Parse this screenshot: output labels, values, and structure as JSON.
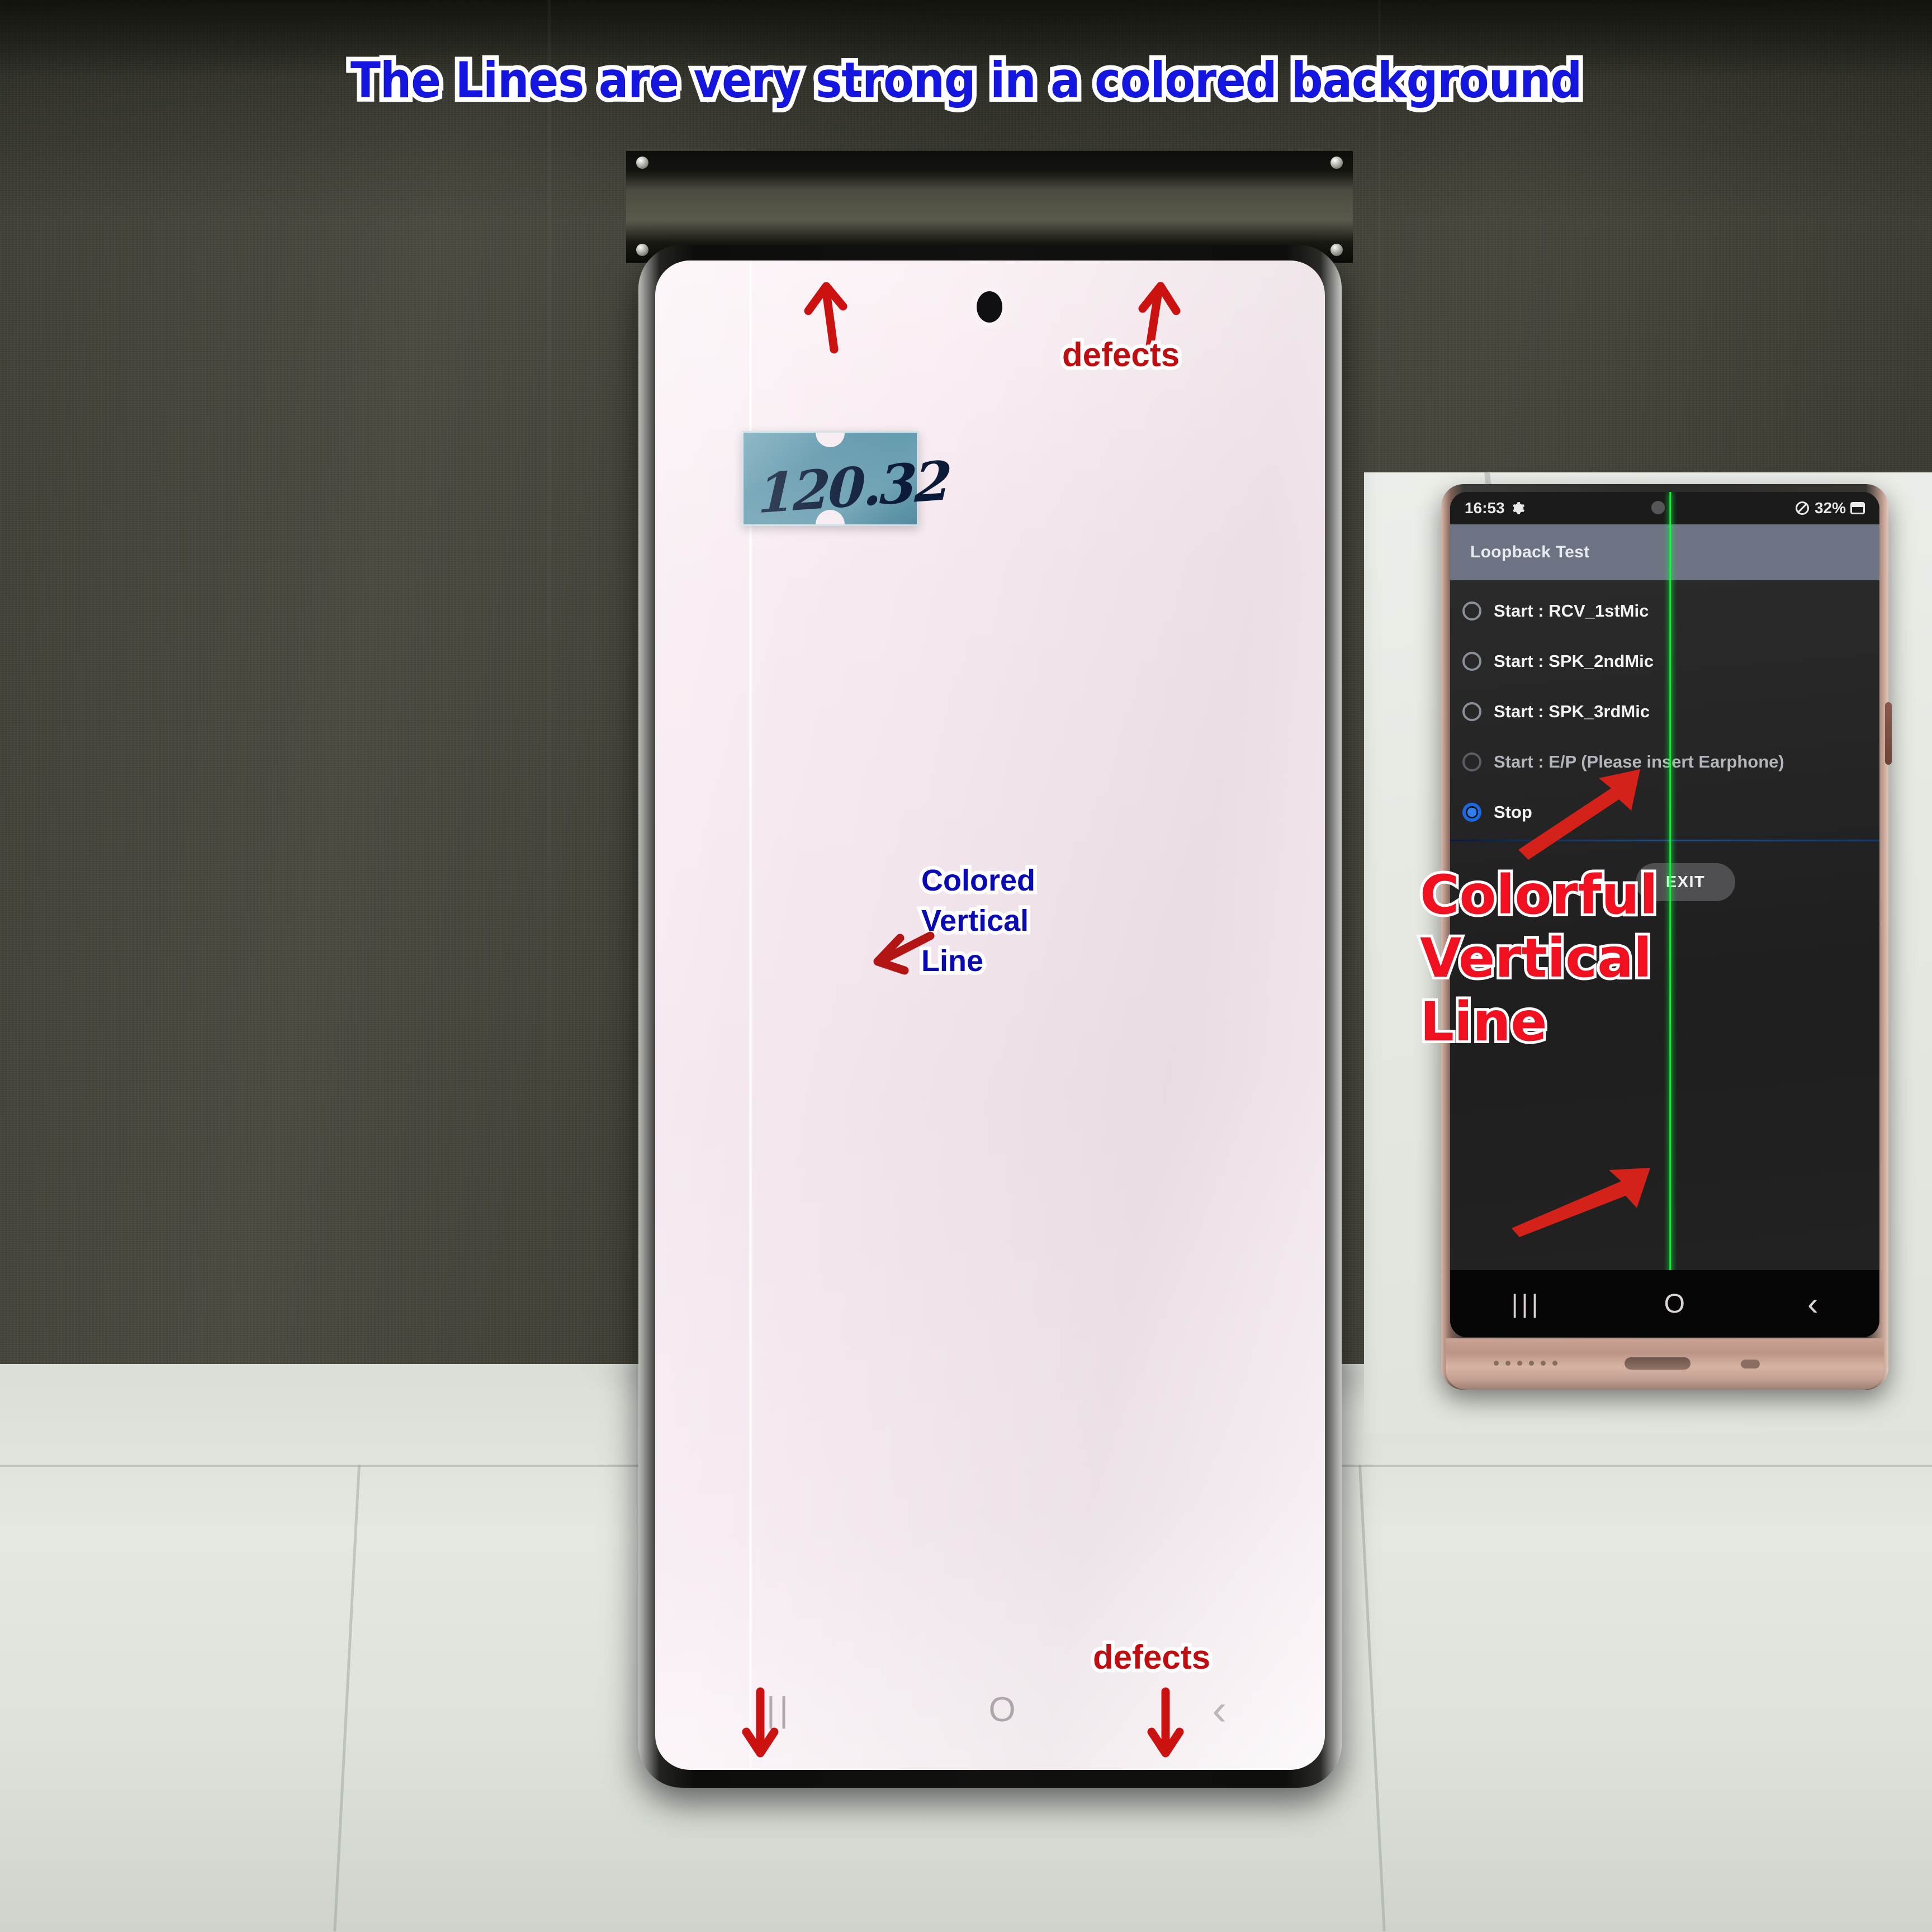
{
  "annotations": {
    "title": "The Lines are very strong in a colored background",
    "title_color": "#1515e0",
    "left_label_line1": "Colored",
    "left_label_line2": "Vertical",
    "left_label_line3": "Line",
    "left_label_color": "#0a0ab4",
    "defects_top": "defects",
    "defects_bottom": "defects",
    "defects_color": "#c00d12",
    "right_label_line1": "Colorful",
    "right_label_line2": "Vertical",
    "right_label_line3": "Line",
    "right_label_color": "#f01020",
    "arrow_color": "#cc1111"
  },
  "left_phone": {
    "sticker_text": "120.32",
    "sticker_color": "#6ea3b4",
    "screen_tint": "#f5e9f0",
    "defect_line_description": "colored vertical line",
    "navbar": {
      "recents": "|||",
      "home": "O",
      "back": "‹"
    }
  },
  "right_phone": {
    "statusbar": {
      "time": "16:53",
      "gear_icon": "gear-icon",
      "mute_icon": "do-not-disturb-icon",
      "battery_percent": "32%"
    },
    "appbar_title": "Loopback Test",
    "options": [
      {
        "label": "Start : RCV_1stMic",
        "checked": false,
        "dimmed": false
      },
      {
        "label": "Start : SPK_2ndMic",
        "checked": false,
        "dimmed": false
      },
      {
        "label": "Start : SPK_3rdMic",
        "checked": false,
        "dimmed": false
      },
      {
        "label": "Start : E/P (Please insert Earphone)",
        "checked": false,
        "dimmed": true
      },
      {
        "label": "Stop",
        "checked": true,
        "dimmed": false
      }
    ],
    "exit_button": "EXIT",
    "defect_line_color": "#00ff2a",
    "navbar": {
      "recents": "|||",
      "home": "O",
      "back": "‹"
    }
  }
}
